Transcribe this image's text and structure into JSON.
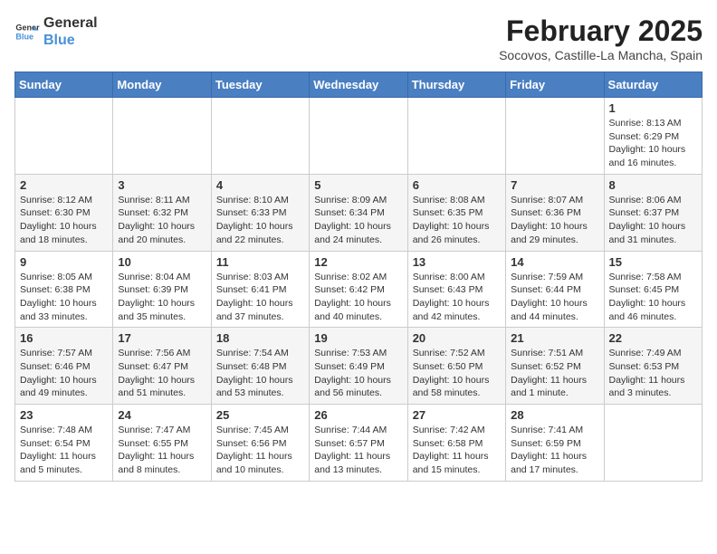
{
  "header": {
    "logo_line1": "General",
    "logo_line2": "Blue",
    "month_year": "February 2025",
    "location": "Socovos, Castille-La Mancha, Spain"
  },
  "days_of_week": [
    "Sunday",
    "Monday",
    "Tuesday",
    "Wednesday",
    "Thursday",
    "Friday",
    "Saturday"
  ],
  "weeks": [
    [
      {
        "day": "",
        "info": ""
      },
      {
        "day": "",
        "info": ""
      },
      {
        "day": "",
        "info": ""
      },
      {
        "day": "",
        "info": ""
      },
      {
        "day": "",
        "info": ""
      },
      {
        "day": "",
        "info": ""
      },
      {
        "day": "1",
        "info": "Sunrise: 8:13 AM\nSunset: 6:29 PM\nDaylight: 10 hours and 16 minutes."
      }
    ],
    [
      {
        "day": "2",
        "info": "Sunrise: 8:12 AM\nSunset: 6:30 PM\nDaylight: 10 hours and 18 minutes."
      },
      {
        "day": "3",
        "info": "Sunrise: 8:11 AM\nSunset: 6:32 PM\nDaylight: 10 hours and 20 minutes."
      },
      {
        "day": "4",
        "info": "Sunrise: 8:10 AM\nSunset: 6:33 PM\nDaylight: 10 hours and 22 minutes."
      },
      {
        "day": "5",
        "info": "Sunrise: 8:09 AM\nSunset: 6:34 PM\nDaylight: 10 hours and 24 minutes."
      },
      {
        "day": "6",
        "info": "Sunrise: 8:08 AM\nSunset: 6:35 PM\nDaylight: 10 hours and 26 minutes."
      },
      {
        "day": "7",
        "info": "Sunrise: 8:07 AM\nSunset: 6:36 PM\nDaylight: 10 hours and 29 minutes."
      },
      {
        "day": "8",
        "info": "Sunrise: 8:06 AM\nSunset: 6:37 PM\nDaylight: 10 hours and 31 minutes."
      }
    ],
    [
      {
        "day": "9",
        "info": "Sunrise: 8:05 AM\nSunset: 6:38 PM\nDaylight: 10 hours and 33 minutes."
      },
      {
        "day": "10",
        "info": "Sunrise: 8:04 AM\nSunset: 6:39 PM\nDaylight: 10 hours and 35 minutes."
      },
      {
        "day": "11",
        "info": "Sunrise: 8:03 AM\nSunset: 6:41 PM\nDaylight: 10 hours and 37 minutes."
      },
      {
        "day": "12",
        "info": "Sunrise: 8:02 AM\nSunset: 6:42 PM\nDaylight: 10 hours and 40 minutes."
      },
      {
        "day": "13",
        "info": "Sunrise: 8:00 AM\nSunset: 6:43 PM\nDaylight: 10 hours and 42 minutes."
      },
      {
        "day": "14",
        "info": "Sunrise: 7:59 AM\nSunset: 6:44 PM\nDaylight: 10 hours and 44 minutes."
      },
      {
        "day": "15",
        "info": "Sunrise: 7:58 AM\nSunset: 6:45 PM\nDaylight: 10 hours and 46 minutes."
      }
    ],
    [
      {
        "day": "16",
        "info": "Sunrise: 7:57 AM\nSunset: 6:46 PM\nDaylight: 10 hours and 49 minutes."
      },
      {
        "day": "17",
        "info": "Sunrise: 7:56 AM\nSunset: 6:47 PM\nDaylight: 10 hours and 51 minutes."
      },
      {
        "day": "18",
        "info": "Sunrise: 7:54 AM\nSunset: 6:48 PM\nDaylight: 10 hours and 53 minutes."
      },
      {
        "day": "19",
        "info": "Sunrise: 7:53 AM\nSunset: 6:49 PM\nDaylight: 10 hours and 56 minutes."
      },
      {
        "day": "20",
        "info": "Sunrise: 7:52 AM\nSunset: 6:50 PM\nDaylight: 10 hours and 58 minutes."
      },
      {
        "day": "21",
        "info": "Sunrise: 7:51 AM\nSunset: 6:52 PM\nDaylight: 11 hours and 1 minute."
      },
      {
        "day": "22",
        "info": "Sunrise: 7:49 AM\nSunset: 6:53 PM\nDaylight: 11 hours and 3 minutes."
      }
    ],
    [
      {
        "day": "23",
        "info": "Sunrise: 7:48 AM\nSunset: 6:54 PM\nDaylight: 11 hours and 5 minutes."
      },
      {
        "day": "24",
        "info": "Sunrise: 7:47 AM\nSunset: 6:55 PM\nDaylight: 11 hours and 8 minutes."
      },
      {
        "day": "25",
        "info": "Sunrise: 7:45 AM\nSunset: 6:56 PM\nDaylight: 11 hours and 10 minutes."
      },
      {
        "day": "26",
        "info": "Sunrise: 7:44 AM\nSunset: 6:57 PM\nDaylight: 11 hours and 13 minutes."
      },
      {
        "day": "27",
        "info": "Sunrise: 7:42 AM\nSunset: 6:58 PM\nDaylight: 11 hours and 15 minutes."
      },
      {
        "day": "28",
        "info": "Sunrise: 7:41 AM\nSunset: 6:59 PM\nDaylight: 11 hours and 17 minutes."
      },
      {
        "day": "",
        "info": ""
      }
    ]
  ]
}
